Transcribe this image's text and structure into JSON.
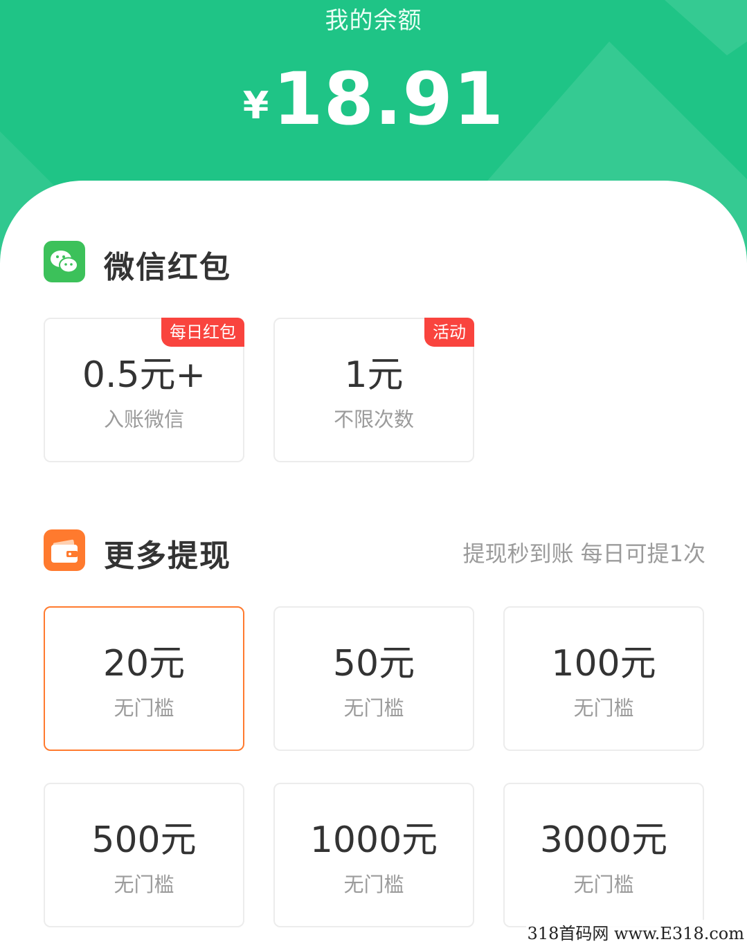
{
  "header": {
    "title": "我的余额",
    "currency_symbol": "¥",
    "balance": "18.91",
    "colors": {
      "accent": "#1fc486"
    }
  },
  "wechat_section": {
    "icon": "wechat-icon",
    "title": "微信红包",
    "cards": [
      {
        "amount": "0.5元+",
        "sub": "入账微信",
        "badge": "每日红包"
      },
      {
        "amount": "1元",
        "sub": "不限次数",
        "badge": "活动"
      }
    ]
  },
  "more_section": {
    "icon": "wallet-icon",
    "title": "更多提现",
    "note": "提现秒到账 每日可提1次",
    "selected_index": 0,
    "cards": [
      {
        "amount": "20元",
        "sub": "无门槛"
      },
      {
        "amount": "50元",
        "sub": "无门槛"
      },
      {
        "amount": "100元",
        "sub": "无门槛"
      },
      {
        "amount": "500元",
        "sub": "无门槛"
      },
      {
        "amount": "1000元",
        "sub": "无门槛"
      },
      {
        "amount": "3000元",
        "sub": "无门槛"
      }
    ]
  },
  "watermark": "318首码网 www.E318.com",
  "colors": {
    "selected_border": "#ff7a2e",
    "badge": "#f9443e",
    "wallet": "#ff7a2e",
    "wechat": "#3cc15a"
  }
}
